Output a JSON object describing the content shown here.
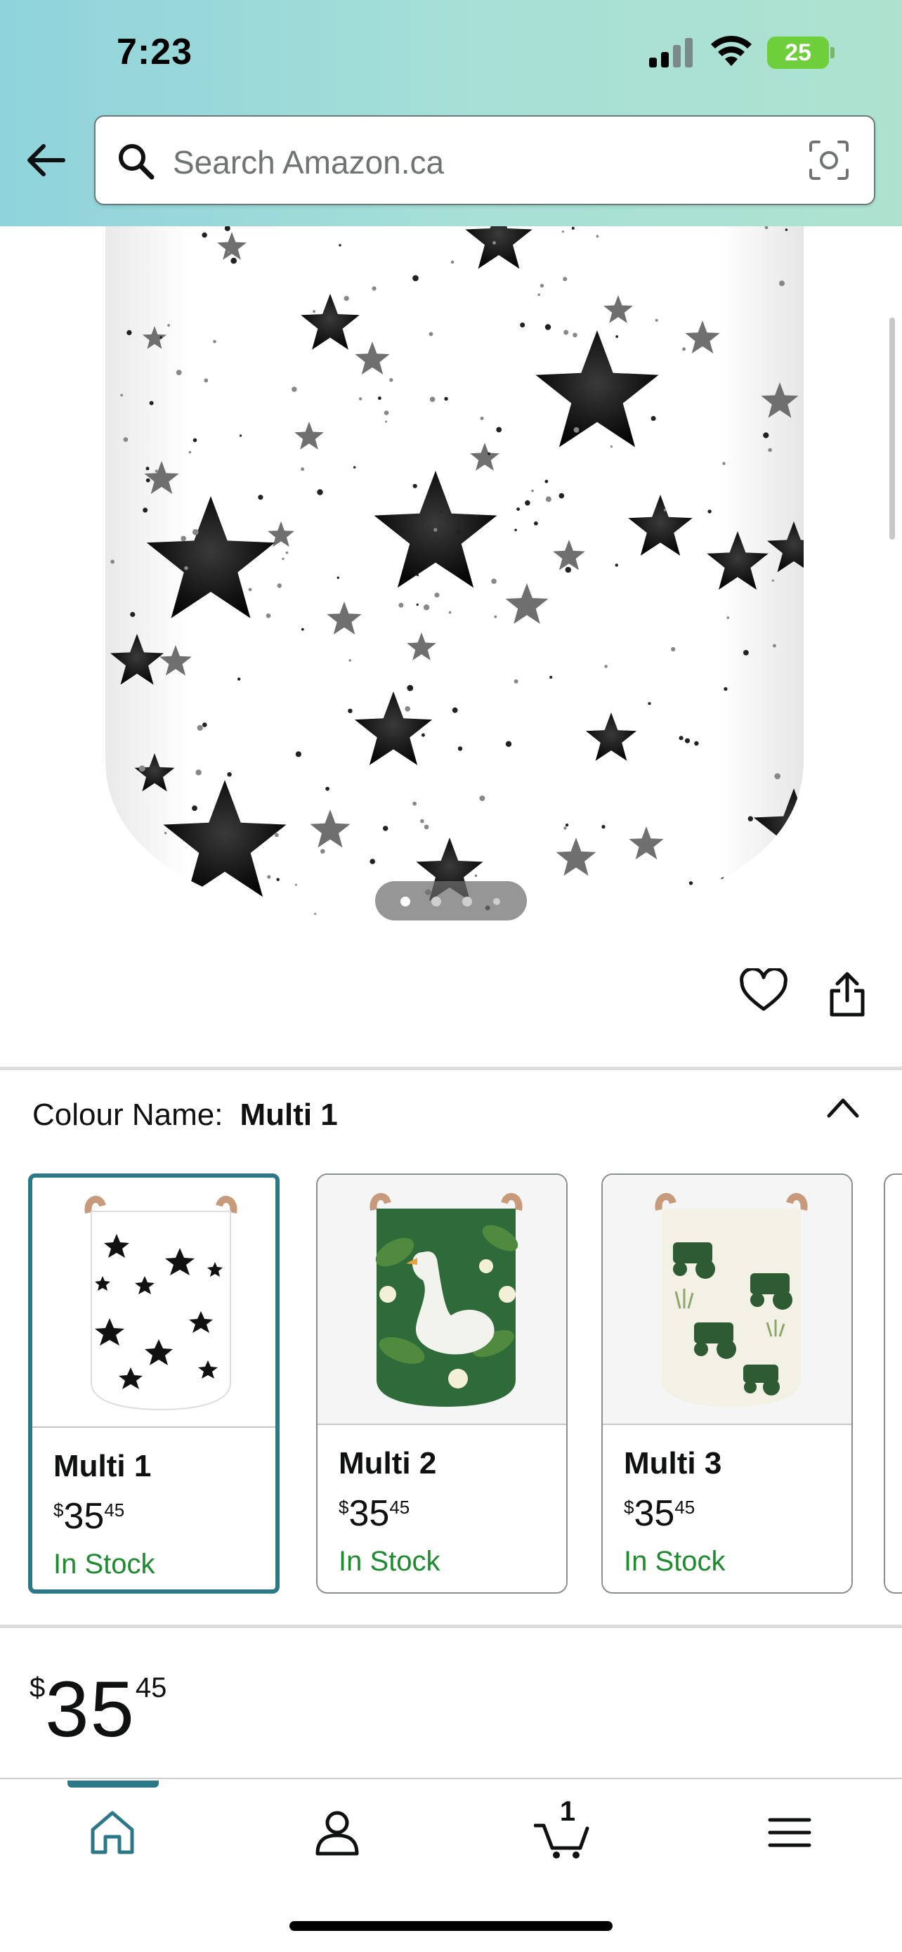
{
  "status_bar": {
    "time": "7:23",
    "battery": "25"
  },
  "search": {
    "placeholder": "Search Amazon.ca"
  },
  "gallery": {
    "dot_count": 4,
    "active_dot": 0
  },
  "colour": {
    "label": "Colour Name:",
    "selected_value": "Multi 1"
  },
  "swatches": [
    {
      "name": "Multi 1",
      "price_symbol": "$",
      "price_whole": "35",
      "price_fraction": "45",
      "stock": "In Stock",
      "selected": true
    },
    {
      "name": "Multi 2",
      "price_symbol": "$",
      "price_whole": "35",
      "price_fraction": "45",
      "stock": "In Stock",
      "selected": false
    },
    {
      "name": "Multi 3",
      "price_symbol": "$",
      "price_whole": "35",
      "price_fraction": "45",
      "stock": "In Stock",
      "selected": false
    }
  ],
  "price": {
    "symbol": "$",
    "whole": "35",
    "fraction": "45"
  },
  "tabbar": {
    "cart_count": "1",
    "active_tab": "home"
  },
  "colors": {
    "accent": "#2d7888",
    "in_stock": "#1f8a2f",
    "header_gradient_start": "#8fd3dc",
    "header_gradient_end": "#aee2cf"
  },
  "icons": [
    "back-arrow-icon",
    "search-icon",
    "camera-icon",
    "heart-icon",
    "share-icon",
    "chevron-up-icon",
    "home-icon",
    "account-icon",
    "cart-icon",
    "menu-icon"
  ]
}
